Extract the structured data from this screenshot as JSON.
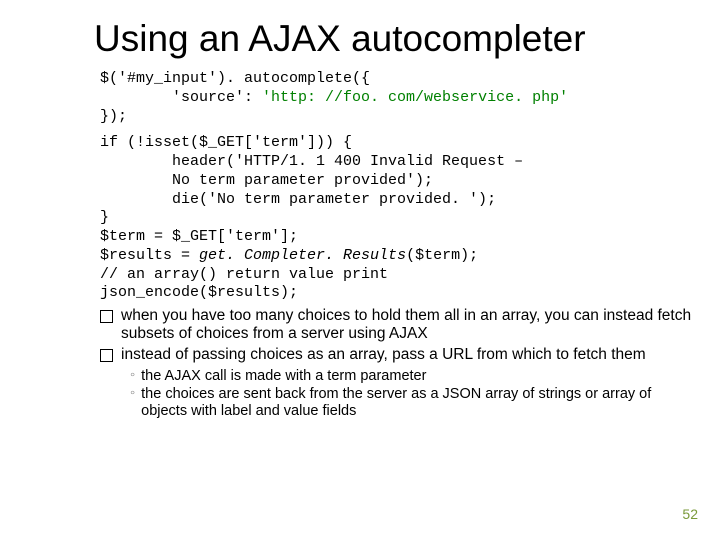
{
  "title": "Using an AJAX autocompleter",
  "code1": {
    "l1a": "$('#my_input'). autocomplete({",
    "l2a": "        'source': ",
    "l2b": "'http: //foo. com/webservice. php'",
    "l3": "});"
  },
  "code2": {
    "l1": "if (!isset($_GET['term'])) {",
    "l2": "        header('HTTP/1. 1 400 Invalid Request –",
    "l3": "        No term parameter provided');",
    "l4": "        die('No term parameter provided. ');",
    "l5": "}",
    "l6": "$term = $_GET['term'];",
    "l7a": "$results = ",
    "l7b": "get. Completer. Results",
    "l7c": "($term);",
    "l8": "// an array() return value print",
    "l9": "json_encode($results);"
  },
  "bullets": {
    "b1": "when you have too many choices to hold them all in an array, you can instead fetch subsets of choices from a server using AJAX",
    "b2": "instead of passing choices as an array, pass a URL from which to fetch them"
  },
  "sub": {
    "s1": "the AJAX call is made with a term parameter",
    "s2": "the choices are sent back from the server as a JSON array of strings or array of objects with label and value fields"
  },
  "pagenum": "52"
}
